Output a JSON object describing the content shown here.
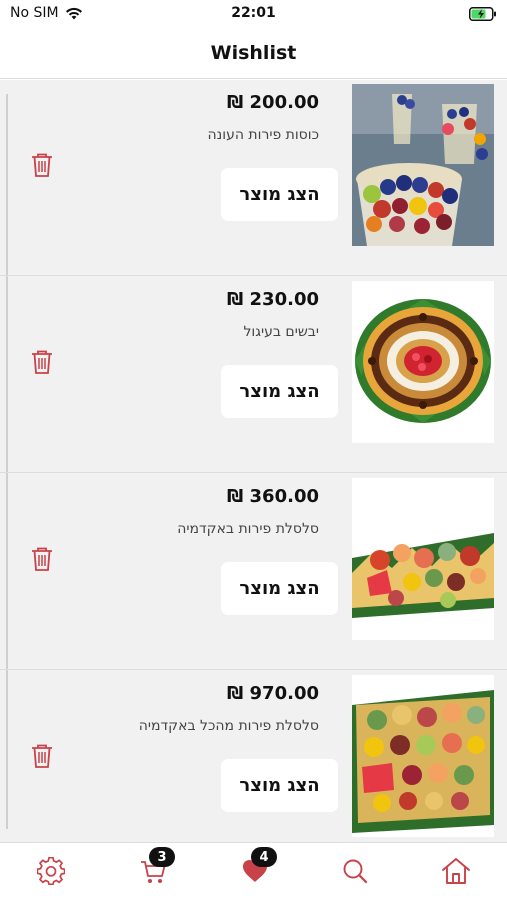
{
  "status_bar": {
    "carrier": "No SIM",
    "time": "22:01"
  },
  "header": {
    "title": "Wishlist"
  },
  "items": [
    {
      "price": "₪ 200.00",
      "name": "כוסות פירות העונה",
      "button_label": "הצג מוצר",
      "image": "fruit-cups-photo"
    },
    {
      "price": "₪ 230.00",
      "name": "יבשים בעיגול",
      "button_label": "הצג מוצר",
      "image": "dried-fruit-platter-photo"
    },
    {
      "price": "₪ 360.00",
      "name": "סלסלת פירות באקדמיה",
      "button_label": "הצג מוצר",
      "image": "fruit-basket-photo"
    },
    {
      "price": "₪ 970.00",
      "name": "סלסלת פירות מהכל באקדמיה",
      "button_label": "הצג מוצר",
      "image": "large-fruit-basket-photo"
    }
  ],
  "tabbar": {
    "cart_count": "3",
    "wishlist_count": "4",
    "icons": [
      "gear-icon",
      "cart-icon",
      "heart-icon",
      "search-icon",
      "home-icon"
    ]
  },
  "colors": {
    "accent": "#c8424a",
    "list_bg": "#f1f1f1",
    "badge_bg": "#111111"
  }
}
